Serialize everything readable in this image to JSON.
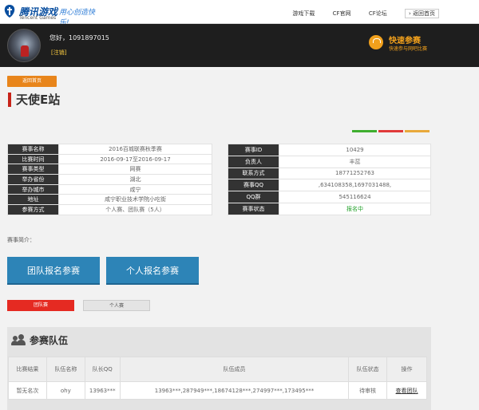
{
  "topbar": {
    "brand": "腾讯游戏",
    "brand_en": "Tencent Games",
    "slogan": "用心创造快乐!",
    "links": [
      "游戏下载",
      "CF官网",
      "CF论坛",
      "返回首页"
    ]
  },
  "user": {
    "greeting": "您好，1091897015",
    "logout": "[注销]"
  },
  "quick_join": {
    "title": "快速参赛",
    "subtitle": "快速参与网吧比赛"
  },
  "back_label": "返回首页",
  "page_title": "天使E站",
  "accent_colors": [
    "#3fae2f",
    "#e03a3a",
    "#e9a93b"
  ],
  "left_info": [
    {
      "key": "赛事名称",
      "value": "2016百城联赛秋季赛"
    },
    {
      "key": "比赛时间",
      "value": "2016-09-17至2016-09-17"
    },
    {
      "key": "赛事类型",
      "value": "网赛"
    },
    {
      "key": "举办省份",
      "value": "湖北"
    },
    {
      "key": "举办城市",
      "value": "咸宁"
    },
    {
      "key": "地址",
      "value": "咸宁职业技术学院小吃街"
    },
    {
      "key": "参赛方式",
      "value": "个人赛、团队赛（5人）"
    }
  ],
  "right_info": [
    {
      "key": "赛事ID",
      "value": "10429"
    },
    {
      "key": "负责人",
      "value": "丰蕊"
    },
    {
      "key": "联系方式",
      "value": "18771252763"
    },
    {
      "key": "赛事QQ",
      "value": ",634108358,1697031488,"
    },
    {
      "key": "QQ群",
      "value": "545116624"
    },
    {
      "key": "赛事状态",
      "value": "报名中",
      "color": "#22a12a"
    }
  ],
  "intro_label": "赛事简介：",
  "buttons": {
    "team_signup": "团队报名参赛",
    "personal_signup": "个人报名参赛"
  },
  "tabs": {
    "team": "团队赛",
    "personal": "个人赛"
  },
  "teams_panel": {
    "title": "参赛队伍",
    "headers": [
      "比赛结果",
      "队伍名称",
      "队长QQ",
      "队伍成员",
      "队伍状态",
      "操作"
    ],
    "rows": [
      [
        "暂无名次",
        "ohy",
        "13963***",
        "13963***,287949***,18674128***,274997***,173495***",
        "待审核",
        "查看团队"
      ]
    ]
  }
}
